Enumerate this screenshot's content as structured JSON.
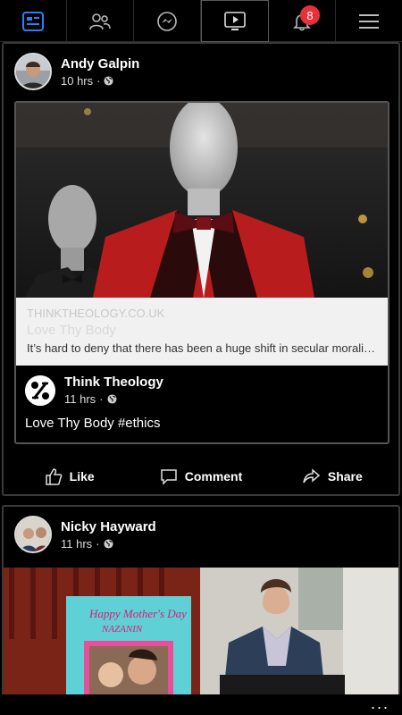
{
  "nav": {
    "tabs": [
      {
        "name": "news-feed",
        "icon": "news-feed-icon",
        "active": true
      },
      {
        "name": "friends",
        "icon": "friends-icon"
      },
      {
        "name": "messenger",
        "icon": "messenger-icon"
      },
      {
        "name": "watch",
        "icon": "video-icon"
      },
      {
        "name": "notifications",
        "icon": "bell-icon",
        "badge": "8"
      },
      {
        "name": "menu",
        "icon": "hamburger-menu-icon"
      }
    ],
    "accent": "#2d7ff9",
    "badge_color": "#e8303a"
  },
  "posts": [
    {
      "author": "Andy Galpin",
      "time": "10 hrs",
      "privacy_icon": "globe-icon",
      "shared": {
        "link": {
          "domain": "THINKTHEOLOGY.CO.UK",
          "title": "Love Thy Body",
          "description": "It’s hard to deny that there has been a huge shift in secular morality…"
        },
        "page": "Think Theology",
        "time": "11 hrs",
        "text": "Love Thy Body #ethics"
      },
      "actions": {
        "like": "Like",
        "comment": "Comment",
        "share": "Share"
      }
    },
    {
      "author": "Nicky Hayward",
      "time": "11 hrs",
      "privacy_icon": "globe-icon",
      "photo_sign": "Happy Mother's Day NAZANIN"
    }
  ],
  "bottom": {
    "more": "..."
  }
}
